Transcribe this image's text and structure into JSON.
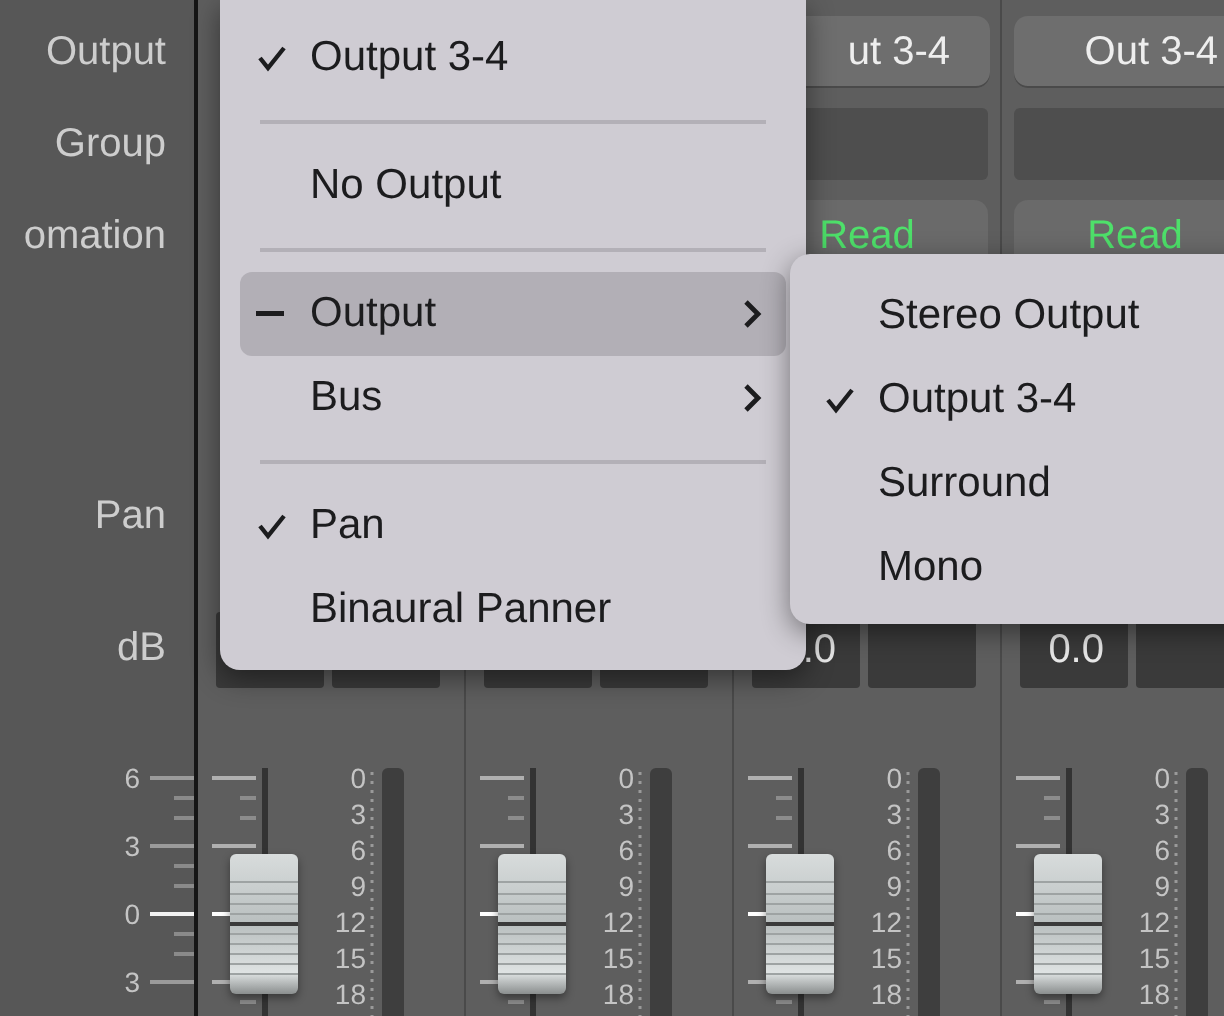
{
  "labels": {
    "output": "Output",
    "group": "Group",
    "automation": "omation",
    "pan": "Pan",
    "db": "dB"
  },
  "fader_scale": [
    "6",
    "3",
    "0",
    "3"
  ],
  "strips": [
    {
      "level": 0.37,
      "meter_scale": [
        "0",
        "3",
        "6",
        "9",
        "12",
        "15",
        "18"
      ]
    },
    {
      "level": 0.37,
      "meter_scale": [
        "0",
        "3",
        "6",
        "9",
        "12",
        "15",
        "18"
      ]
    },
    {
      "output": "ut 3-4",
      "automation": "Read",
      "db": ".0",
      "level": 0.37,
      "meter_scale": [
        "0",
        "3",
        "6",
        "9",
        "12",
        "15",
        "18"
      ]
    },
    {
      "output": "Out 3-4",
      "automation": "Read",
      "db": "0.0",
      "level": 0.37,
      "meter_scale": [
        "0",
        "3",
        "6",
        "9",
        "12",
        "15",
        "18"
      ]
    }
  ],
  "menu": {
    "items": [
      {
        "kind": "item",
        "label": "Output 3-4",
        "checked": true,
        "mixed": false,
        "submenu": false,
        "selected": false
      },
      {
        "kind": "separator"
      },
      {
        "kind": "item",
        "label": "No Output",
        "checked": false,
        "mixed": false,
        "submenu": false,
        "selected": false
      },
      {
        "kind": "separator"
      },
      {
        "kind": "item",
        "label": "Output",
        "checked": false,
        "mixed": true,
        "submenu": true,
        "selected": true
      },
      {
        "kind": "item",
        "label": "Bus",
        "checked": false,
        "mixed": false,
        "submenu": true,
        "selected": false
      },
      {
        "kind": "separator"
      },
      {
        "kind": "item",
        "label": "Pan",
        "checked": true,
        "mixed": false,
        "submenu": false,
        "selected": false
      },
      {
        "kind": "item",
        "label": "Binaural Panner",
        "checked": false,
        "mixed": false,
        "submenu": false,
        "selected": false
      }
    ]
  },
  "submenu": {
    "items": [
      {
        "label": "Stereo Output",
        "checked": false
      },
      {
        "label": "Output 3-4",
        "checked": true
      },
      {
        "label": "Surround",
        "checked": false
      },
      {
        "label": "Mono",
        "checked": false
      }
    ]
  }
}
